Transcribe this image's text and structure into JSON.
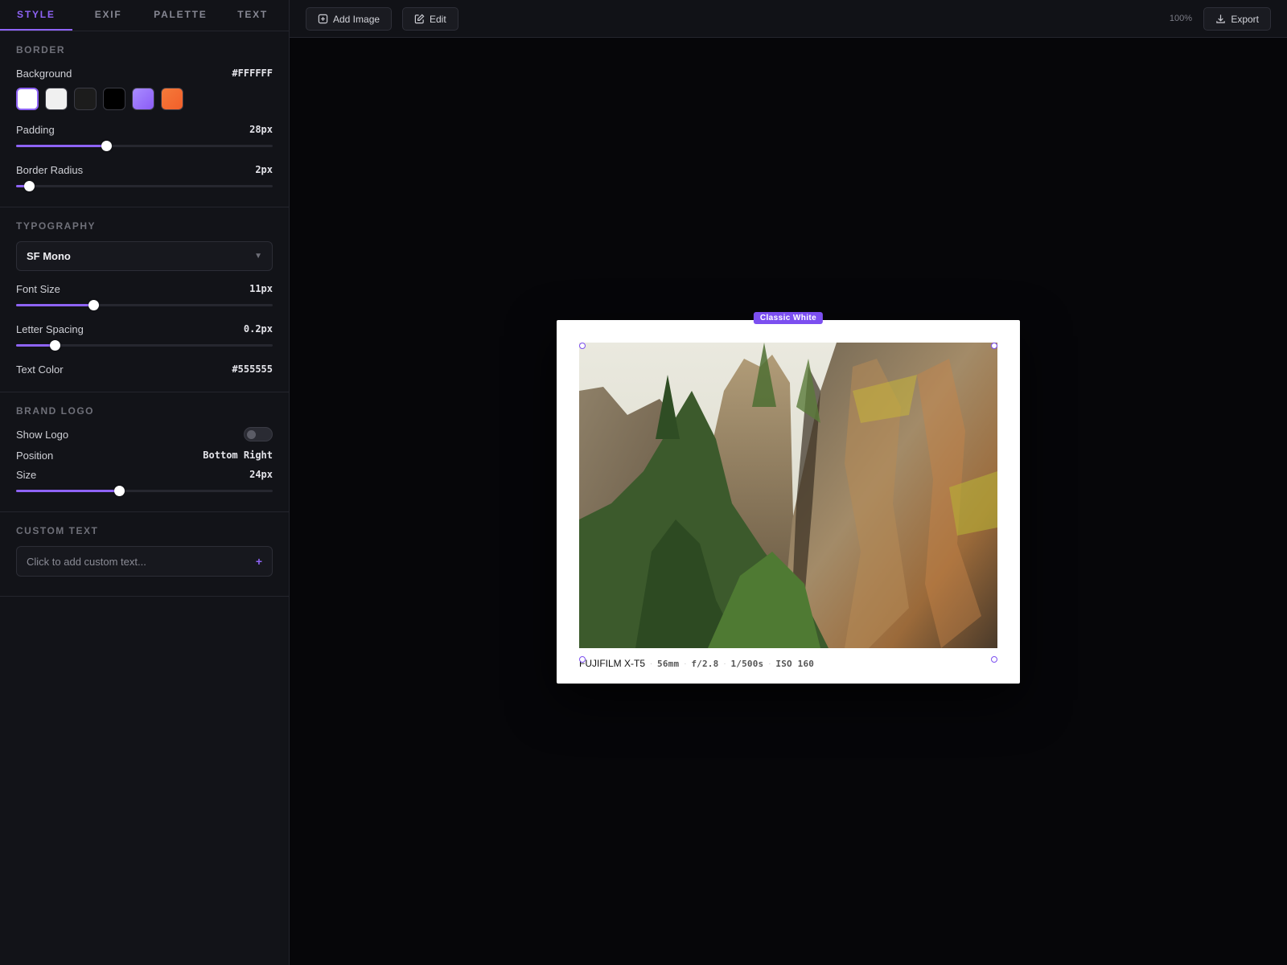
{
  "tabs": [
    "STYLE",
    "EXIF",
    "PALETTE",
    "TEXT"
  ],
  "border": {
    "title": "BORDER",
    "background_label": "Background",
    "background_value": "#FFFFFF",
    "swatches": [
      "#FFFFFF",
      "#F0F0F0",
      "#1C1C1C",
      "#000000",
      "#8B5CF6",
      "#F25F2A"
    ],
    "padding_label": "Padding",
    "padding_value": "28px",
    "padding_level": 0.35,
    "radius_label": "Border Radius",
    "radius_value": "2px",
    "radius_level": 0.05
  },
  "typography": {
    "title": "TYPOGRAPHY",
    "font": "SF Mono",
    "font_size_label": "Font Size",
    "font_size_value": "11px",
    "font_size_level": 0.3,
    "spacing_label": "Letter Spacing",
    "spacing_value": "0.2px",
    "spacing_level": 0.15,
    "text_color_label": "Text Color",
    "text_color_value": "#555555"
  },
  "brand": {
    "title": "BRAND LOGO",
    "show_label": "Show Logo",
    "show_logo": false,
    "position_label": "Position",
    "position_value": "Bottom Right",
    "size_label": "Size",
    "size_value": "24px",
    "size_level": 0.4
  },
  "custom_text": {
    "title": "CUSTOM TEXT",
    "placeholder": "Click to add custom text...",
    "plus": "+"
  },
  "toolbar": {
    "add_image": "Add Image",
    "edit": "Edit",
    "zoom": "100%",
    "export": "Export"
  },
  "preview": {
    "preset": "Classic White",
    "camera": "FUJIFILM X-T5",
    "focal": "56mm",
    "aperture": "f/2.8",
    "shutter": "1/500s",
    "iso": "ISO 160",
    "separator": "·"
  },
  "colors": {
    "accent": "#8E63F5",
    "frame_bg": "#FFFFFF"
  }
}
